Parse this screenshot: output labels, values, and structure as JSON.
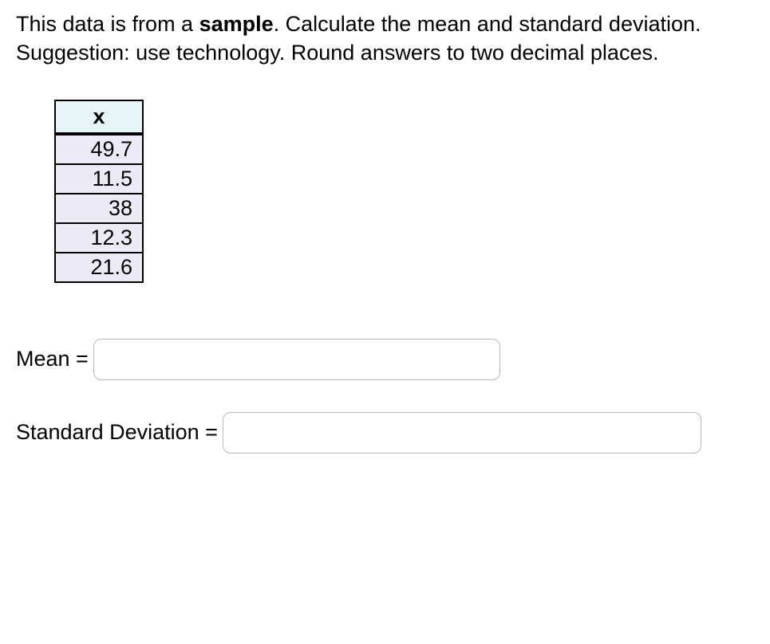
{
  "prompt": {
    "part1": "This data is from a ",
    "bold": "sample",
    "part2": ". Calculate the mean and standard deviation. Suggestion: use technology. Round answers to two decimal places."
  },
  "table": {
    "header": "x",
    "rows": [
      "49.7",
      "11.5",
      "38",
      "12.3",
      "21.6"
    ]
  },
  "answers": {
    "mean_label": "Mean = ",
    "mean_value": "",
    "sd_label": "Standard Deviation = ",
    "sd_value": ""
  }
}
